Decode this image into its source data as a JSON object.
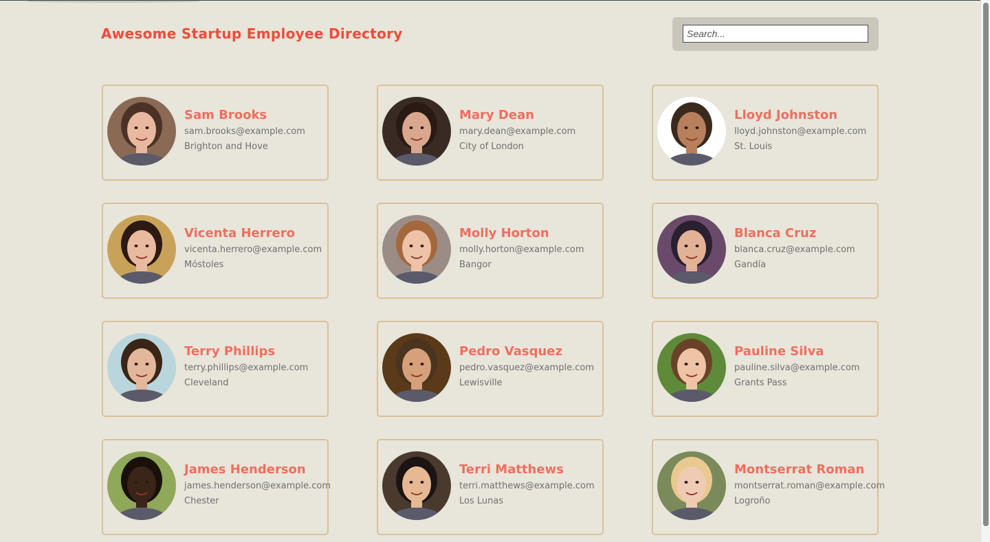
{
  "header": {
    "title": "Awesome Startup Employee Directory"
  },
  "search": {
    "placeholder": "Search..."
  },
  "employees": [
    {
      "name": "Sam Brooks",
      "email": "sam.brooks@example.com",
      "city": "Brighton and Hove",
      "skin": "#e8b9a0",
      "hair": "#4a3326",
      "bg": "#8a6a55"
    },
    {
      "name": "Mary Dean",
      "email": "mary.dean@example.com",
      "city": "City of London",
      "skin": "#d9a78d",
      "hair": "#2a1a14",
      "bg": "#3a2a24"
    },
    {
      "name": "Lloyd Johnston",
      "email": "lloyd.johnston@example.com",
      "city": "St. Louis",
      "skin": "#b77f5c",
      "hair": "#3a2a1e",
      "bg": "#ffffff"
    },
    {
      "name": "Vicenta Herrero",
      "email": "vicenta.herrero@example.com",
      "city": "Móstoles",
      "skin": "#e8bba0",
      "hair": "#2c1a12",
      "bg": "#c9a25a"
    },
    {
      "name": "Molly Horton",
      "email": "molly.horton@example.com",
      "city": "Bangor",
      "skin": "#eec2a8",
      "hair": "#a4683c",
      "bg": "#9b8d86"
    },
    {
      "name": "Blanca Cruz",
      "email": "blanca.cruz@example.com",
      "city": "Gandía",
      "skin": "#e3b296",
      "hair": "#2a2030",
      "bg": "#6a4a6a"
    },
    {
      "name": "Terry Phillips",
      "email": "terry.phillips@example.com",
      "city": "Cleveland",
      "skin": "#e3b79b",
      "hair": "#3a2618",
      "bg": "#b9d6dc"
    },
    {
      "name": "Pedro Vasquez",
      "email": "pedro.vasquez@example.com",
      "city": "Lewisville",
      "skin": "#d6a07a",
      "hair": "#4a3420",
      "bg": "#5a3a18"
    },
    {
      "name": "Pauline Silva",
      "email": "pauline.silva@example.com",
      "city": "Grants Pass",
      "skin": "#eec3a6",
      "hair": "#6a4228",
      "bg": "#5f8a3a"
    },
    {
      "name": "James Henderson",
      "email": "james.henderson@example.com",
      "city": "Chester",
      "skin": "#3b2418",
      "hair": "#1a100a",
      "bg": "#8fa85a"
    },
    {
      "name": "Terri Matthews",
      "email": "terri.matthews@example.com",
      "city": "Los Lunas",
      "skin": "#e7b894",
      "hair": "#1a1412",
      "bg": "#4a3a2e"
    },
    {
      "name": "Montserrat Roman",
      "email": "montserrat.roman@example.com",
      "city": "Logroño",
      "skin": "#f0cbb4",
      "hair": "#e9c98f",
      "bg": "#7a8a5a"
    }
  ]
}
